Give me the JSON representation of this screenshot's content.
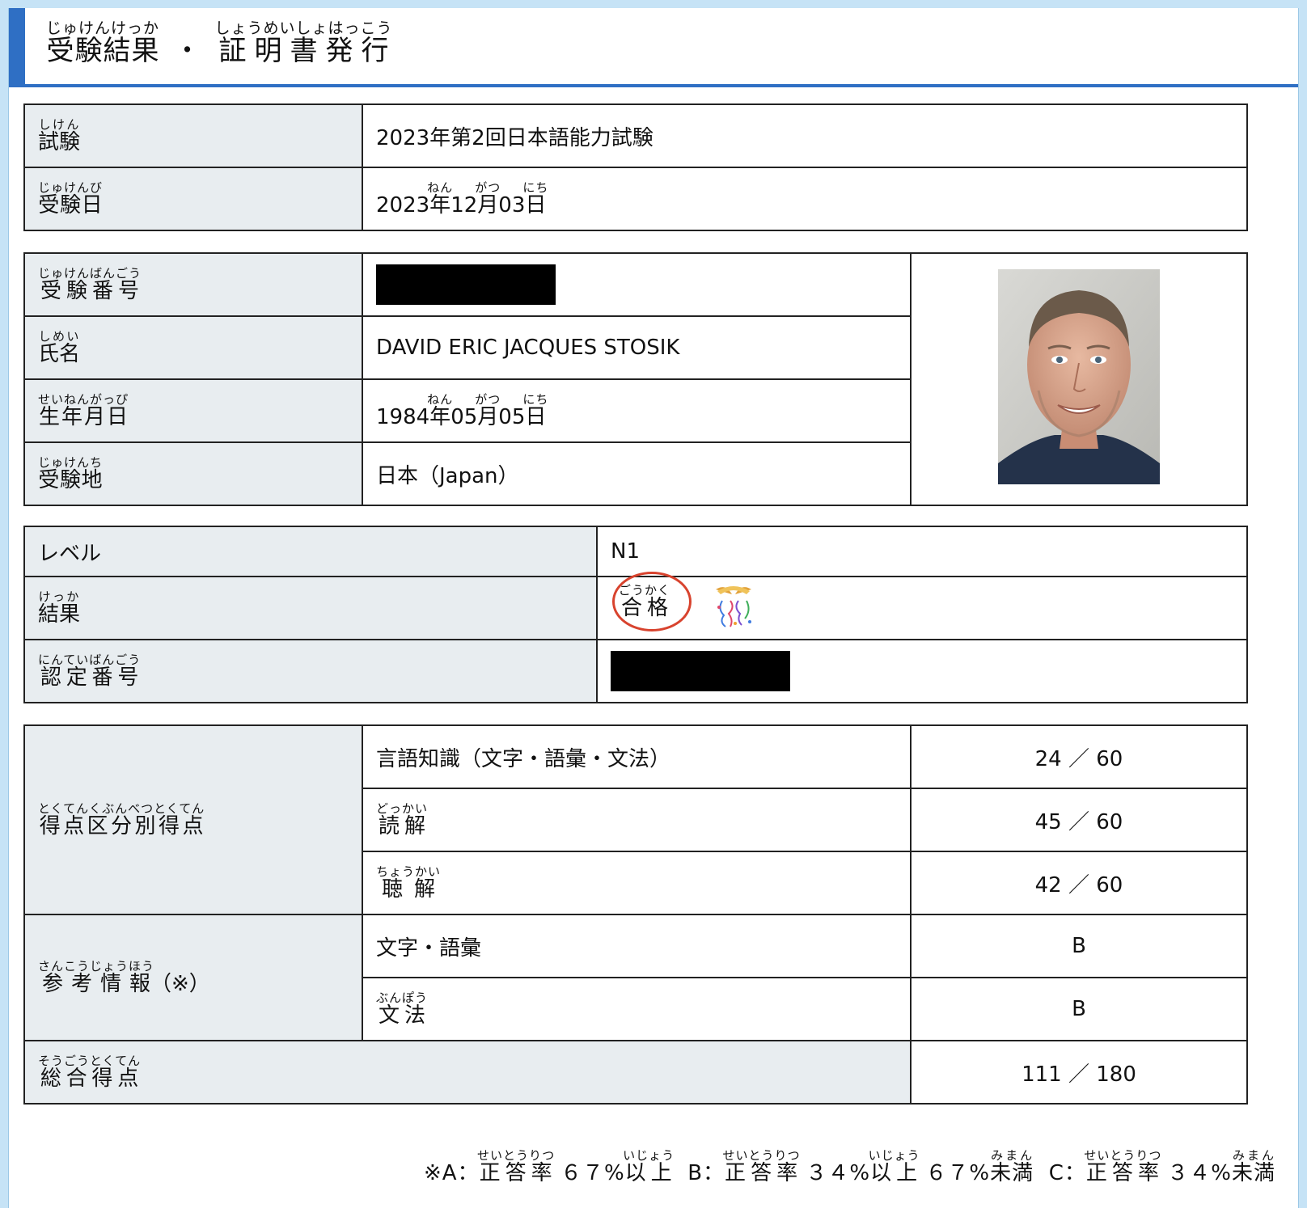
{
  "page": {
    "title_parts": [
      {
        "base": "受験結果",
        "ruby": "じゅけんけっか"
      },
      {
        "sep": "・"
      },
      {
        "base": "証明書発行",
        "ruby": "しょうめいしょはっこう"
      }
    ]
  },
  "exam_info": {
    "exam_label": {
      "base": "試験",
      "ruby": "しけん"
    },
    "exam_value": "2023年第2回日本語能力試験",
    "date_label": {
      "base": "受験日",
      "ruby": "じゅけんび"
    },
    "date_year": "2023",
    "date_month": "12",
    "date_day": "03",
    "nen": {
      "base": "年",
      "ruby": "ねん"
    },
    "gatsu": {
      "base": "月",
      "ruby": "がつ"
    },
    "nichi": {
      "base": "日",
      "ruby": "にち"
    }
  },
  "candidate": {
    "number_label": {
      "base": "受験番号",
      "ruby": "じゅけんばんごう"
    },
    "number_value": "[redacted]",
    "name_label": {
      "base": "氏名",
      "ruby": "しめい"
    },
    "name_value": "DAVID ERIC JACQUES STOSIK",
    "birth_label": {
      "base": "生年月日",
      "ruby": "せいねんがっぴ"
    },
    "birth_year": "1984",
    "birth_month": "05",
    "birth_day": "05",
    "place_label": {
      "base": "受験地",
      "ruby": "じゅけんち"
    },
    "place_value": "日本（Japan）",
    "photo_icon": "portrait-photo"
  },
  "result": {
    "level_label": "レベル",
    "level_value": "N1",
    "result_label": {
      "base": "結果",
      "ruby": "けっか"
    },
    "result_value": {
      "base": "合格",
      "ruby": "ごうかく"
    },
    "celebrate_icon": "party-popper-icon",
    "cert_label": {
      "base": "認定番号",
      "ruby": "にんていばんごう"
    },
    "cert_value": "[redacted]"
  },
  "scores": {
    "section_label": {
      "base": "得点区分別得点",
      "ruby": "とくてんくぶんべつとくてん"
    },
    "rows": [
      {
        "label": "言語知識（文字・語彙・文法）",
        "score": "24 ／ 60"
      },
      {
        "label": {
          "base": "読解",
          "ruby": "どっかい"
        },
        "score": "45 ／ 60"
      },
      {
        "label": {
          "base": "聴解",
          "ruby": "ちょうかい"
        },
        "score": "42 ／ 60"
      }
    ],
    "ref_label": {
      "base": "参考情報",
      "ruby": "さんこうじょうほう",
      "suffix": "（※）"
    },
    "ref_rows": [
      {
        "label": "文字・語彙",
        "grade": "B"
      },
      {
        "label": {
          "base": "文法",
          "ruby": "ぶんぽう"
        },
        "grade": "B"
      }
    ],
    "total_label": {
      "base": "総合得点",
      "ruby": "そうごうとくてん"
    },
    "total_value": "111 ／ 180"
  },
  "footnote": {
    "prefix": "※A：",
    "rate": {
      "base": "正答率",
      "ruby": "せいとうりつ"
    },
    "above": {
      "base": "以上",
      "ruby": "いじょう"
    },
    "below": {
      "base": "未満",
      "ruby": "みまん"
    },
    "a_value": "６７%",
    "b_prefix": "B：",
    "b_low": "３４%",
    "b_high": "６７%",
    "c_prefix": "C：",
    "c_value": "３４%"
  }
}
